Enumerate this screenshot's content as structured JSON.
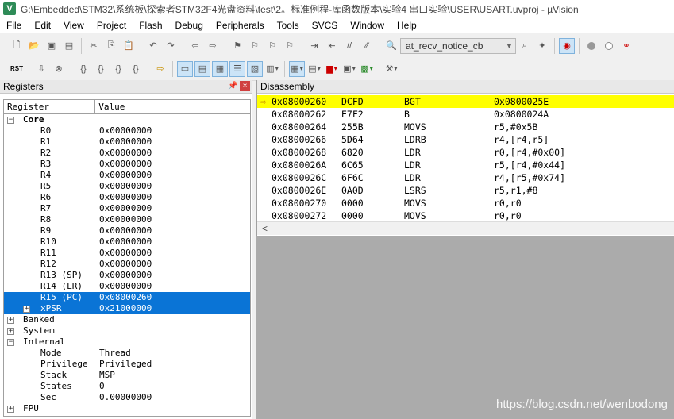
{
  "window": {
    "title": "G:\\Embedded\\STM32\\系统板\\探索者STM32F4光盘资料\\test\\2。标准例程-库函数版本\\实验4 串口实验\\USER\\USART.uvproj - µVision",
    "icon": "uvision-icon"
  },
  "menu": [
    "File",
    "Edit",
    "View",
    "Project",
    "Flash",
    "Debug",
    "Peripherals",
    "Tools",
    "SVCS",
    "Window",
    "Help"
  ],
  "toolbar": {
    "function_combo": "at_recv_notice_cb"
  },
  "registers_panel": {
    "title": "Registers",
    "columns": [
      "Register",
      "Value"
    ],
    "core_label": "Core",
    "rows": [
      {
        "name": "R0",
        "value": "0x00000000"
      },
      {
        "name": "R1",
        "value": "0x00000000"
      },
      {
        "name": "R2",
        "value": "0x00000000"
      },
      {
        "name": "R3",
        "value": "0x00000000"
      },
      {
        "name": "R4",
        "value": "0x00000000"
      },
      {
        "name": "R5",
        "value": "0x00000000"
      },
      {
        "name": "R6",
        "value": "0x00000000"
      },
      {
        "name": "R7",
        "value": "0x00000000"
      },
      {
        "name": "R8",
        "value": "0x00000000"
      },
      {
        "name": "R9",
        "value": "0x00000000"
      },
      {
        "name": "R10",
        "value": "0x00000000"
      },
      {
        "name": "R11",
        "value": "0x00000000"
      },
      {
        "name": "R12",
        "value": "0x00000000"
      },
      {
        "name": "R13 (SP)",
        "value": "0x00000000"
      },
      {
        "name": "R14 (LR)",
        "value": "0x00000000"
      },
      {
        "name": "R15 (PC)",
        "value": "0x08000260"
      },
      {
        "name": "xPSR",
        "value": "0x21000000"
      }
    ],
    "groups": [
      "Banked",
      "System",
      "Internal"
    ],
    "internal_rows": [
      {
        "name": "Mode",
        "value": "Thread"
      },
      {
        "name": "Privilege",
        "value": "Privileged"
      },
      {
        "name": "Stack",
        "value": "MSP"
      },
      {
        "name": "States",
        "value": "0"
      },
      {
        "name": "Sec",
        "value": "0.00000000"
      }
    ],
    "fpu_label": "FPU"
  },
  "disassembly_panel": {
    "title": "Disassembly",
    "rows": [
      {
        "addr": "0x08000260",
        "opcode": "DCFD",
        "mnemonic": "BGT",
        "operands": "0x0800025E",
        "current": true
      },
      {
        "addr": "0x08000262",
        "opcode": "E7F2",
        "mnemonic": "B",
        "operands": "0x0800024A"
      },
      {
        "addr": "0x08000264",
        "opcode": "255B",
        "mnemonic": "MOVS",
        "operands": "r5,#0x5B"
      },
      {
        "addr": "0x08000266",
        "opcode": "5D64",
        "mnemonic": "LDRB",
        "operands": "r4,[r4,r5]"
      },
      {
        "addr": "0x08000268",
        "opcode": "6820",
        "mnemonic": "LDR",
        "operands": "r0,[r4,#0x00]"
      },
      {
        "addr": "0x0800026A",
        "opcode": "6C65",
        "mnemonic": "LDR",
        "operands": "r5,[r4,#0x44]"
      },
      {
        "addr": "0x0800026C",
        "opcode": "6F6C",
        "mnemonic": "LDR",
        "operands": "r4,[r5,#0x74]"
      },
      {
        "addr": "0x0800026E",
        "opcode": "0A0D",
        "mnemonic": "LSRS",
        "operands": "r5,r1,#8"
      },
      {
        "addr": "0x08000270",
        "opcode": "0000",
        "mnemonic": "MOVS",
        "operands": "r0,r0"
      },
      {
        "addr": "0x08000272",
        "opcode": "0000",
        "mnemonic": "MOVS",
        "operands": "r0,r0"
      }
    ]
  },
  "watermark": "https://blog.csdn.net/wenbodong"
}
